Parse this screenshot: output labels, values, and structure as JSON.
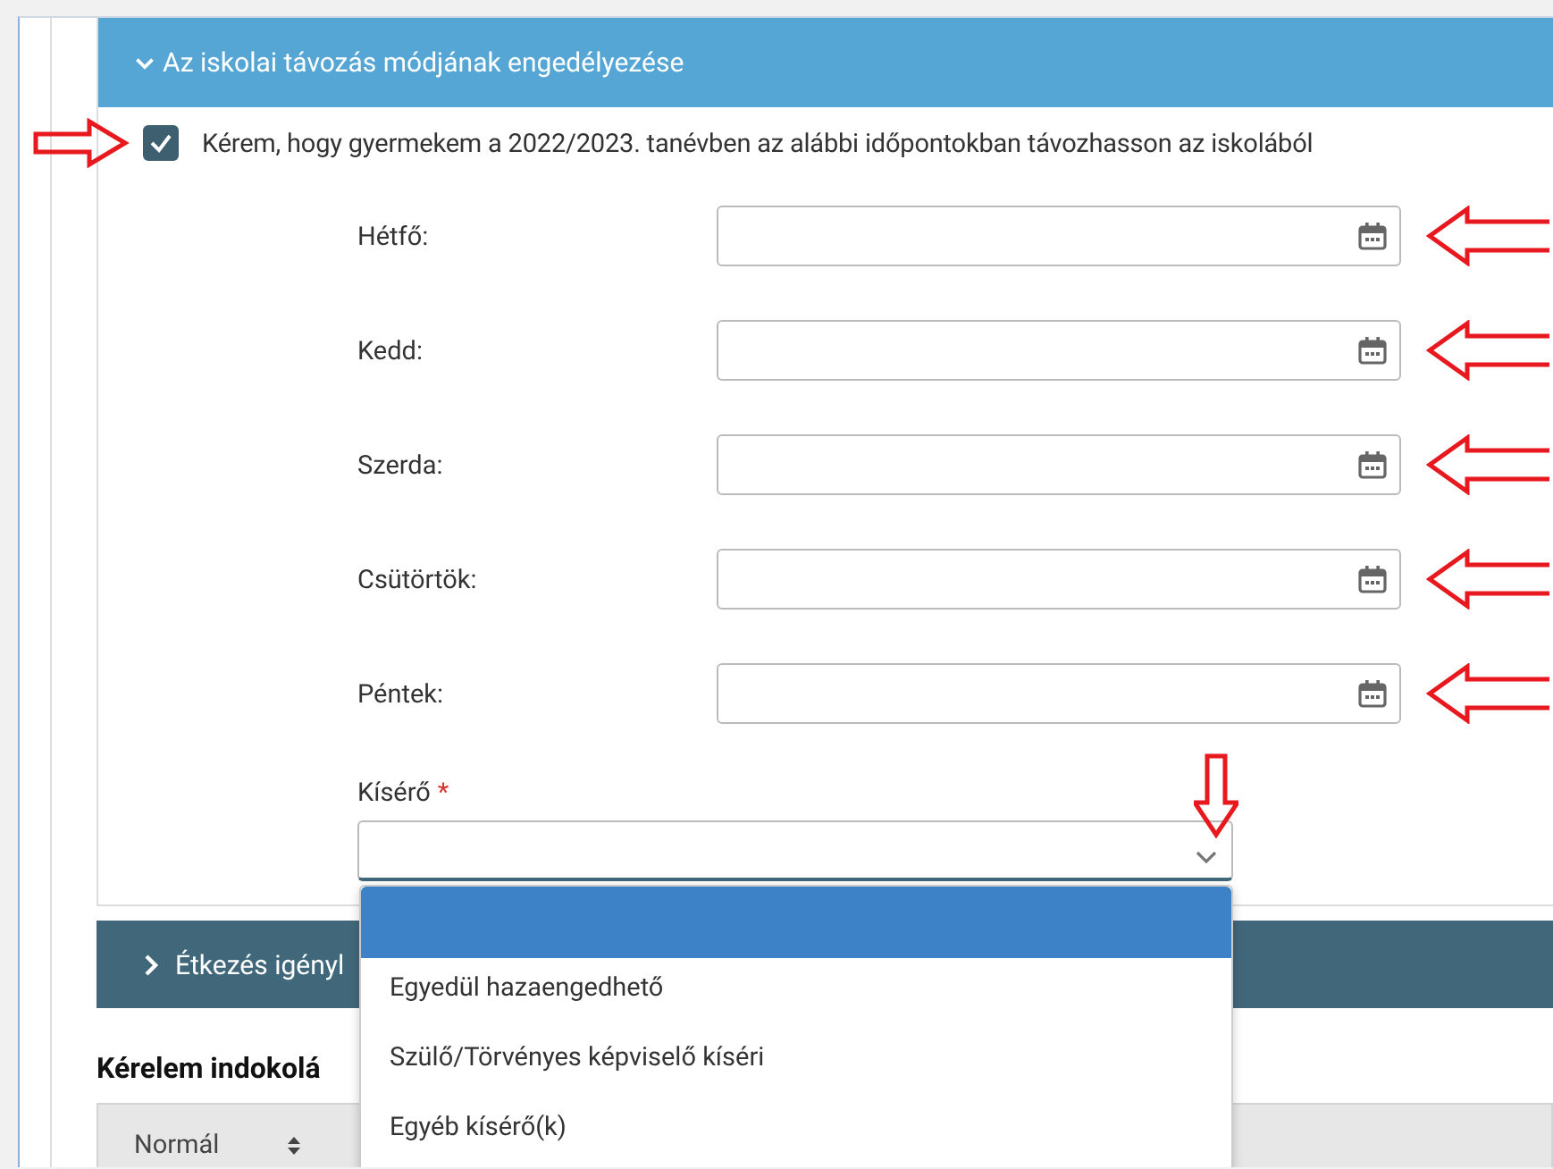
{
  "leave_panel": {
    "title": "Az iskolai távozás módjának engedélyezése",
    "expanded": true
  },
  "consent": {
    "label": "Kérem, hogy gyermekem a 2022/2023. tanévben az alábbi időpontokban távozhasson az iskolából",
    "checked": true,
    "marked": true
  },
  "days": [
    {
      "label": "Hétfő:",
      "marked": true
    },
    {
      "label": "Kedd:",
      "marked": true
    },
    {
      "label": "Szerda:",
      "marked": true
    },
    {
      "label": "Csütörtök:",
      "marked": true
    },
    {
      "label": "Péntek:",
      "marked": true
    }
  ],
  "companion": {
    "label": "Kísérő",
    "required_mark": "*",
    "marked": true,
    "open": true,
    "options": [
      {
        "selected": true
      },
      {
        "label": "Egyedül hazaengedhető",
        "selected": false
      },
      {
        "label": "Szülő/Törvényes képviselő kíséri",
        "selected": false
      },
      {
        "label": "Egyéb kísérő(k)",
        "selected": false
      }
    ]
  },
  "meals_panel": {
    "title": "Étkezés igényl",
    "expanded": false
  },
  "justification": {
    "title": "Kérelem indokolá",
    "format": "Normál"
  }
}
